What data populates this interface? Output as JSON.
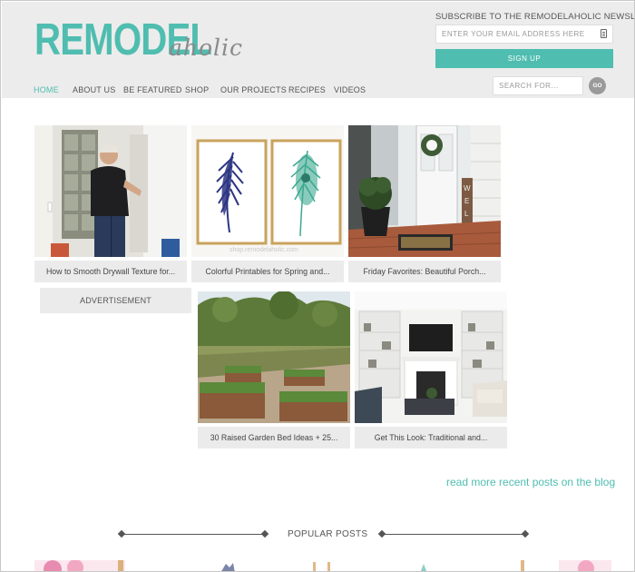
{
  "header": {
    "logo_main": "REMODEL",
    "logo_script": "aholic",
    "newsletter_title": "SUBSCRIBE TO THE REMODELAHOLIC NEWSLETTER",
    "email_placeholder": "ENTER YOUR EMAIL ADDRESS HERE",
    "signup_label": "SIGN UP"
  },
  "nav": {
    "items": [
      {
        "label": "HOME",
        "active": true
      },
      {
        "label": "ABOUT US",
        "active": false
      },
      {
        "label": "BE FEATURED",
        "active": false
      },
      {
        "label": "SHOP",
        "active": false
      },
      {
        "label": "OUR PROJECTS",
        "active": false
      },
      {
        "label": "RECIPES",
        "active": false
      },
      {
        "label": "VIDEOS",
        "active": false
      }
    ],
    "search_placeholder": "SEARCH FOR...",
    "go_label": "GO"
  },
  "posts": [
    {
      "caption": "How to Smooth Drywall Texture for..."
    },
    {
      "caption": "Colorful Printables for Spring and..."
    },
    {
      "caption": "Friday Favorites: Beautiful Porch..."
    },
    {
      "caption": "30 Raised Garden Bed Ideas + 25..."
    },
    {
      "caption": "Get This Look: Traditional and..."
    }
  ],
  "advertisement_label": "ADVERTISEMENT",
  "watermark": "shop.remodelaholic.com",
  "read_more": "read more recent posts on the blog",
  "popular_title": "POPULAR POSTS",
  "colors": {
    "accent": "#4fbdb0",
    "header_bg": "#ececec",
    "caption_bg": "#ebebeb"
  }
}
